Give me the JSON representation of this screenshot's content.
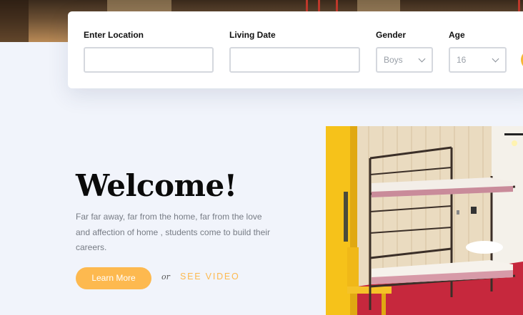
{
  "hero": {
    "image": "hostel-interior-photo"
  },
  "search": {
    "location_label": "Enter Location",
    "location_value": "",
    "living_date_label": "Living Date",
    "living_date_value": "",
    "gender_label": "Gender",
    "gender_value": "Boys",
    "age_label": "Age",
    "age_value": "16",
    "dropdown_icon": "chevron-down-icon"
  },
  "welcome": {
    "title": "Welcome!",
    "text": "Far far away, far from the home, far from the love and affection of home , students come to build their careers.",
    "learn_more": "Learn More",
    "or": "or",
    "see_video": "SEE VIDEO"
  },
  "colors": {
    "accent": "#fdb94f",
    "background": "#f1f4fb",
    "text_muted": "#777c85"
  },
  "room_image": "bunk-bed-room-photo"
}
